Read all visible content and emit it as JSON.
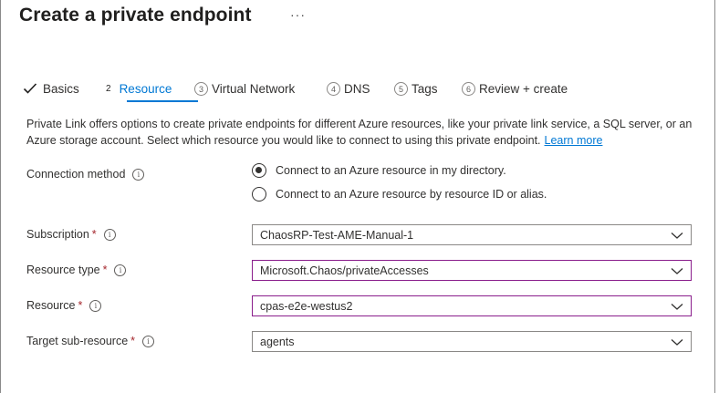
{
  "header": {
    "title": "Create a private endpoint",
    "more_label": "···"
  },
  "tabs": [
    {
      "num": "",
      "label": "Basics",
      "state": "complete"
    },
    {
      "num": "2",
      "label": "Resource",
      "state": "active"
    },
    {
      "num": "3",
      "label": "Virtual Network",
      "state": "pending"
    },
    {
      "num": "4",
      "label": "DNS",
      "state": "pending"
    },
    {
      "num": "5",
      "label": "Tags",
      "state": "pending"
    },
    {
      "num": "6",
      "label": "Review + create",
      "state": "pending"
    }
  ],
  "description": {
    "text": "Private Link offers options to create private endpoints for different Azure resources, like your private link service, a SQL server, or an Azure storage account. Select which resource you would like to connect to using this private endpoint.",
    "link": "Learn more"
  },
  "connection_method": {
    "label": "Connection method",
    "options": [
      {
        "label": "Connect to an Azure resource in my directory.",
        "selected": true
      },
      {
        "label": "Connect to an Azure resource by resource ID or alias.",
        "selected": false
      }
    ]
  },
  "fields": {
    "subscription": {
      "label": "Subscription",
      "required": "*",
      "value": "ChaosRP-Test-AME-Manual-1"
    },
    "resource_type": {
      "label": "Resource type",
      "required": "*",
      "value": "Microsoft.Chaos/privateAccesses"
    },
    "resource": {
      "label": "Resource",
      "required": "*",
      "value": "cpas-e2e-westus2"
    },
    "target_sub_resource": {
      "label": "Target sub-resource",
      "required": "*",
      "value": "agents"
    }
  },
  "colors": {
    "accent": "#0078d4",
    "focus_border": "#8a1e8c",
    "required": "#a4262c"
  },
  "icons": {
    "info": "info-icon",
    "chevron": "chevron-down-icon",
    "check": "checkmark-icon"
  }
}
